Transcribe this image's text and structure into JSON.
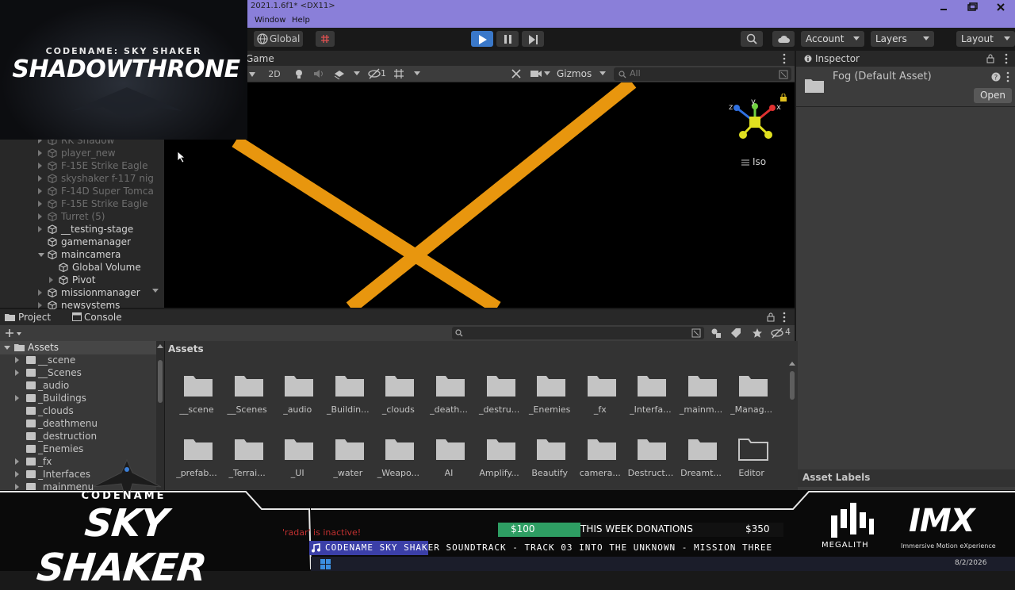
{
  "window": {
    "title": "2021.1.6f1* <DX11>",
    "menu": [
      "Window",
      "Help"
    ]
  },
  "toolbar": {
    "global_label": "Global",
    "account_label": "Account",
    "layers_label": "Layers",
    "layout_label": "Layout"
  },
  "scene": {
    "tab_label": "Game",
    "mode_2d": "2D",
    "layer_count": "1",
    "gizmos_label": "Gizmos",
    "search_placeholder": "All",
    "projection_label": "Iso",
    "axis_labels": {
      "x": "x",
      "y": "y",
      "z": "z"
    }
  },
  "hierarchy": {
    "items": [
      {
        "label": "RK Shadow",
        "depth": 0,
        "expand": "collapsed",
        "dim": true
      },
      {
        "label": "player_new",
        "depth": 0,
        "expand": "collapsed",
        "dim": true
      },
      {
        "label": "F-15E Strike Eagle",
        "depth": 0,
        "expand": "collapsed",
        "dim": true
      },
      {
        "label": "skyshaker f-117 nig",
        "depth": 0,
        "expand": "collapsed",
        "dim": true
      },
      {
        "label": "F-14D Super Tomca",
        "depth": 0,
        "expand": "collapsed",
        "dim": true
      },
      {
        "label": "F-15E Strike Eagle",
        "depth": 0,
        "expand": "collapsed",
        "dim": true
      },
      {
        "label": "Turret (5)",
        "depth": 0,
        "expand": "collapsed",
        "dim": true
      },
      {
        "label": "__testing-stage",
        "depth": 0,
        "expand": "collapsed",
        "dim": false
      },
      {
        "label": "gamemanager",
        "depth": 0,
        "expand": "none",
        "dim": false
      },
      {
        "label": "maincamera",
        "depth": 0,
        "expand": "expanded",
        "dim": false
      },
      {
        "label": "Global Volume",
        "depth": 1,
        "expand": "none",
        "dim": false
      },
      {
        "label": "Pivot",
        "depth": 1,
        "expand": "collapsed",
        "dim": false
      },
      {
        "label": "missionmanager",
        "depth": 0,
        "expand": "collapsed",
        "dim": false
      },
      {
        "label": "newsystems",
        "depth": 0,
        "expand": "collapsed",
        "dim": false
      }
    ]
  },
  "inspector": {
    "tab_label": "Inspector",
    "asset_title": "Fog (Default Asset)",
    "open_label": "Open",
    "asset_labels_header": "Asset Labels"
  },
  "project": {
    "tab_project": "Project",
    "tab_console": "Console",
    "hidden_count": "4",
    "tree_root": "Assets",
    "tree_items": [
      {
        "label": "__scene",
        "arrow": true
      },
      {
        "label": "__Scenes",
        "arrow": true
      },
      {
        "label": "_audio",
        "arrow": false
      },
      {
        "label": "_Buildings",
        "arrow": true
      },
      {
        "label": "_clouds",
        "arrow": false
      },
      {
        "label": "_deathmenu",
        "arrow": false
      },
      {
        "label": "_destruction",
        "arrow": false
      },
      {
        "label": "_Enemies",
        "arrow": false
      },
      {
        "label": "_fx",
        "arrow": true
      },
      {
        "label": "_Interfaces",
        "arrow": true
      },
      {
        "label": "_mainmenu",
        "arrow": true
      }
    ],
    "breadcrumb": "Assets",
    "folders_row1": [
      "__scene",
      "__Scenes",
      "_audio",
      "_Buildin...",
      "_clouds",
      "_death...",
      "_destru...",
      "_Enemies",
      "_fx",
      "_Interfa...",
      "_mainm...",
      "_Manag..."
    ],
    "folders_row2": [
      "_prefab...",
      "_Terrai...",
      "_UI",
      "_water",
      "_Weapo...",
      "AI",
      "Amplify...",
      "Beautify",
      "camera...",
      "Destruct...",
      "Dreamt...",
      "Editor"
    ]
  },
  "overlay": {
    "codename_top": "CODENAME: SKY SHAKER",
    "shadowthrone": "SHADOWTHRONE",
    "codename_bottom": "CODENAME",
    "skyshaker": "SKY SHAKER",
    "console_message": "'radar' is inactive!",
    "donation_goal": "$100",
    "donations_label": "THIS WEEK DONATIONS",
    "donation_total": "$350",
    "ticker": "CODENAME SKY SHAKER SOUNDTRACK - TRACK 03  INTO THE UNKNOWN - MISSION THREE",
    "megalith": "MEGALITH",
    "imx": "IMX",
    "imx_sub": "Immersive Motion eXperience",
    "date": "8/2/2026",
    "donation_progress": 0.29
  },
  "colors": {
    "accent_play": "#3a78c9",
    "scene_line": "#e8960e",
    "title_bar": "#8a7fd9"
  }
}
